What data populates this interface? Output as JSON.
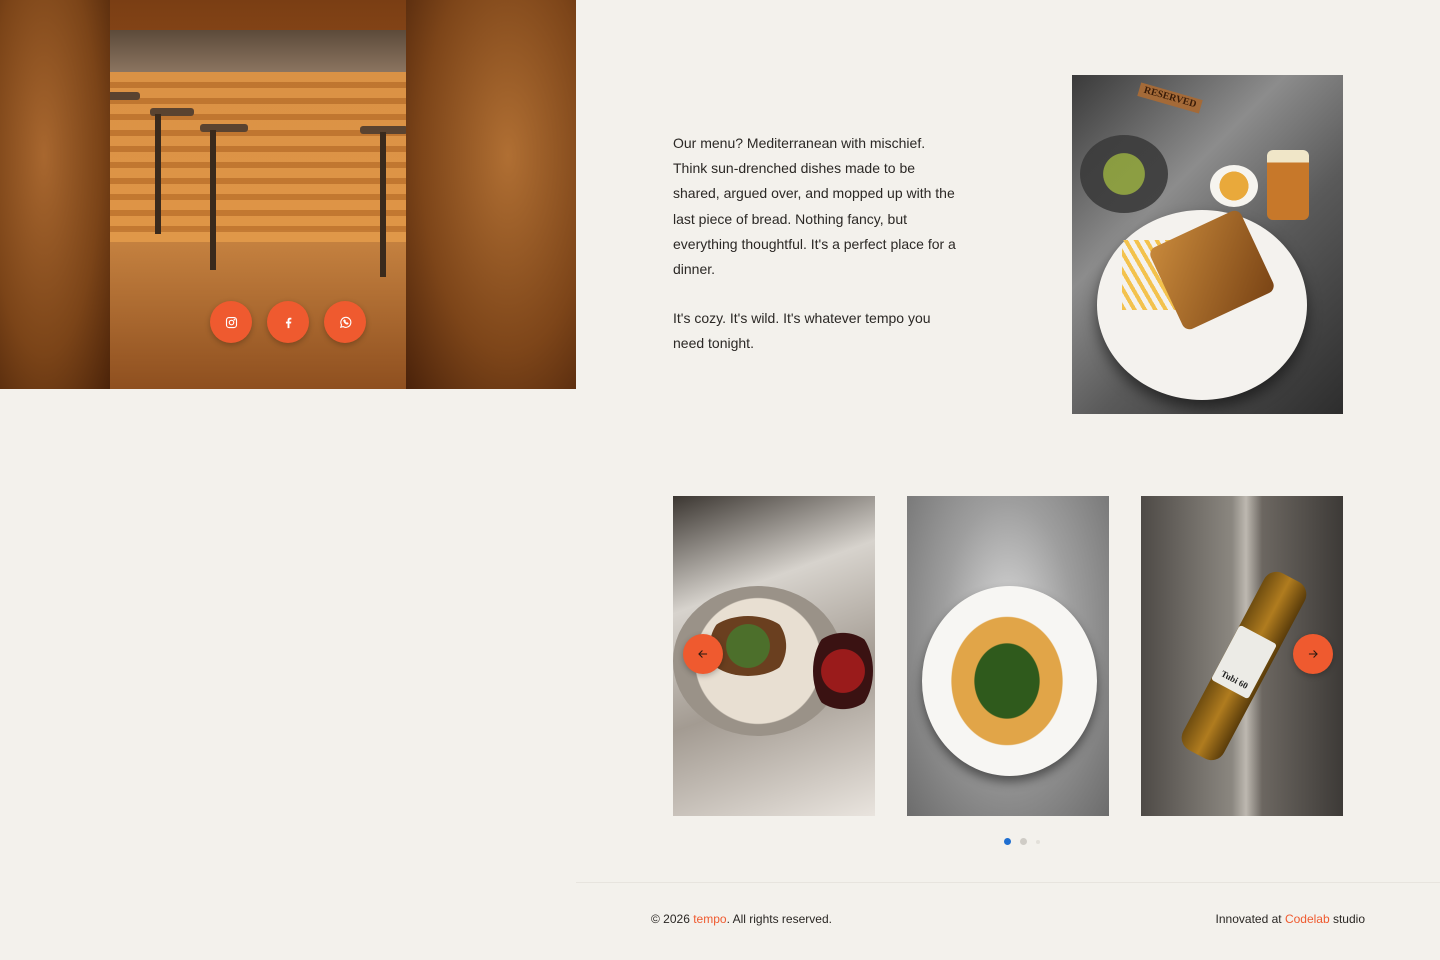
{
  "social": {
    "items": [
      {
        "name": "instagram",
        "icon": "instagram-icon"
      },
      {
        "name": "facebook",
        "icon": "facebook-icon"
      },
      {
        "name": "whatsapp",
        "icon": "whatsapp-icon"
      }
    ]
  },
  "intro": {
    "paragraph1": "Our menu? Mediterranean with mischief. Think sun-drenched dishes made to be shared, argued over, and mopped up with the last piece of bread. Nothing fancy, but everything thoughtful. It's a perfect place for a dinner.",
    "paragraph2": "It's cozy. It's wild. It's whatever tempo you need tonight."
  },
  "photo_main": {
    "sign_text": "RESERVED"
  },
  "carousel": {
    "prev_icon": "arrow-left-icon",
    "next_icon": "arrow-right-icon",
    "bottle_label": "Tubi 60",
    "active_dot": 0,
    "dot_count": 3
  },
  "footer": {
    "copyright_prefix": "© 2026 ",
    "brand": "tempo",
    "copyright_suffix": ". All rights reserved.",
    "credit_prefix": "Innovated at ",
    "studio": "Codelab",
    "credit_suffix": " studio"
  },
  "colors": {
    "background": "#f3f1ec",
    "accent": "#ef5a2f",
    "active_dot": "#1f6fd1"
  }
}
